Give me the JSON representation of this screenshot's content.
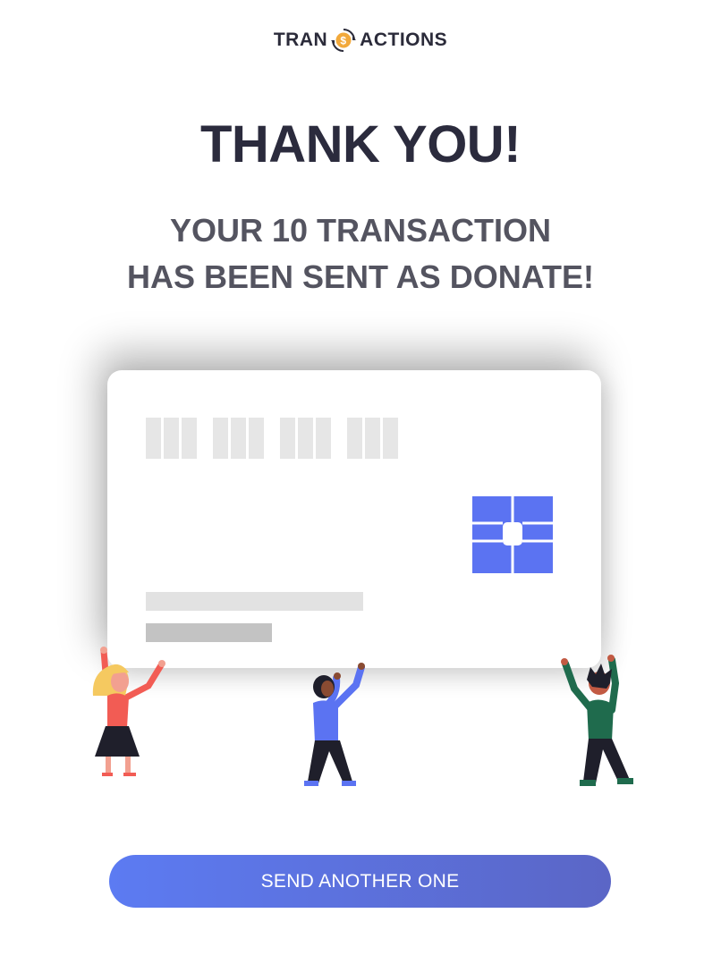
{
  "logo": {
    "text_left": "TRAN",
    "text_right": "ACTIONS",
    "icon": "dollar-coin-icon",
    "accent": "#f2a93b"
  },
  "title": "THANK YOU!",
  "subtitle": {
    "line1": "YOUR 10 TRANSACTION",
    "line2": "HAS BEEN SENT AS DONATE!"
  },
  "card": {
    "chip_color": "#5b73f2"
  },
  "people": [
    {
      "name": "person-left",
      "shirt": "#f25c54",
      "hair": "#f5c960"
    },
    {
      "name": "person-center",
      "shirt": "#5b73f2",
      "hair": "#1f1f2b"
    },
    {
      "name": "person-right",
      "shirt": "#1f6b4d",
      "hair": "#1f1f2b"
    }
  ],
  "cta": {
    "label": "SEND ANOTHER ONE",
    "gradient_start": "#5c7bf2",
    "gradient_end": "#5b66c6"
  }
}
